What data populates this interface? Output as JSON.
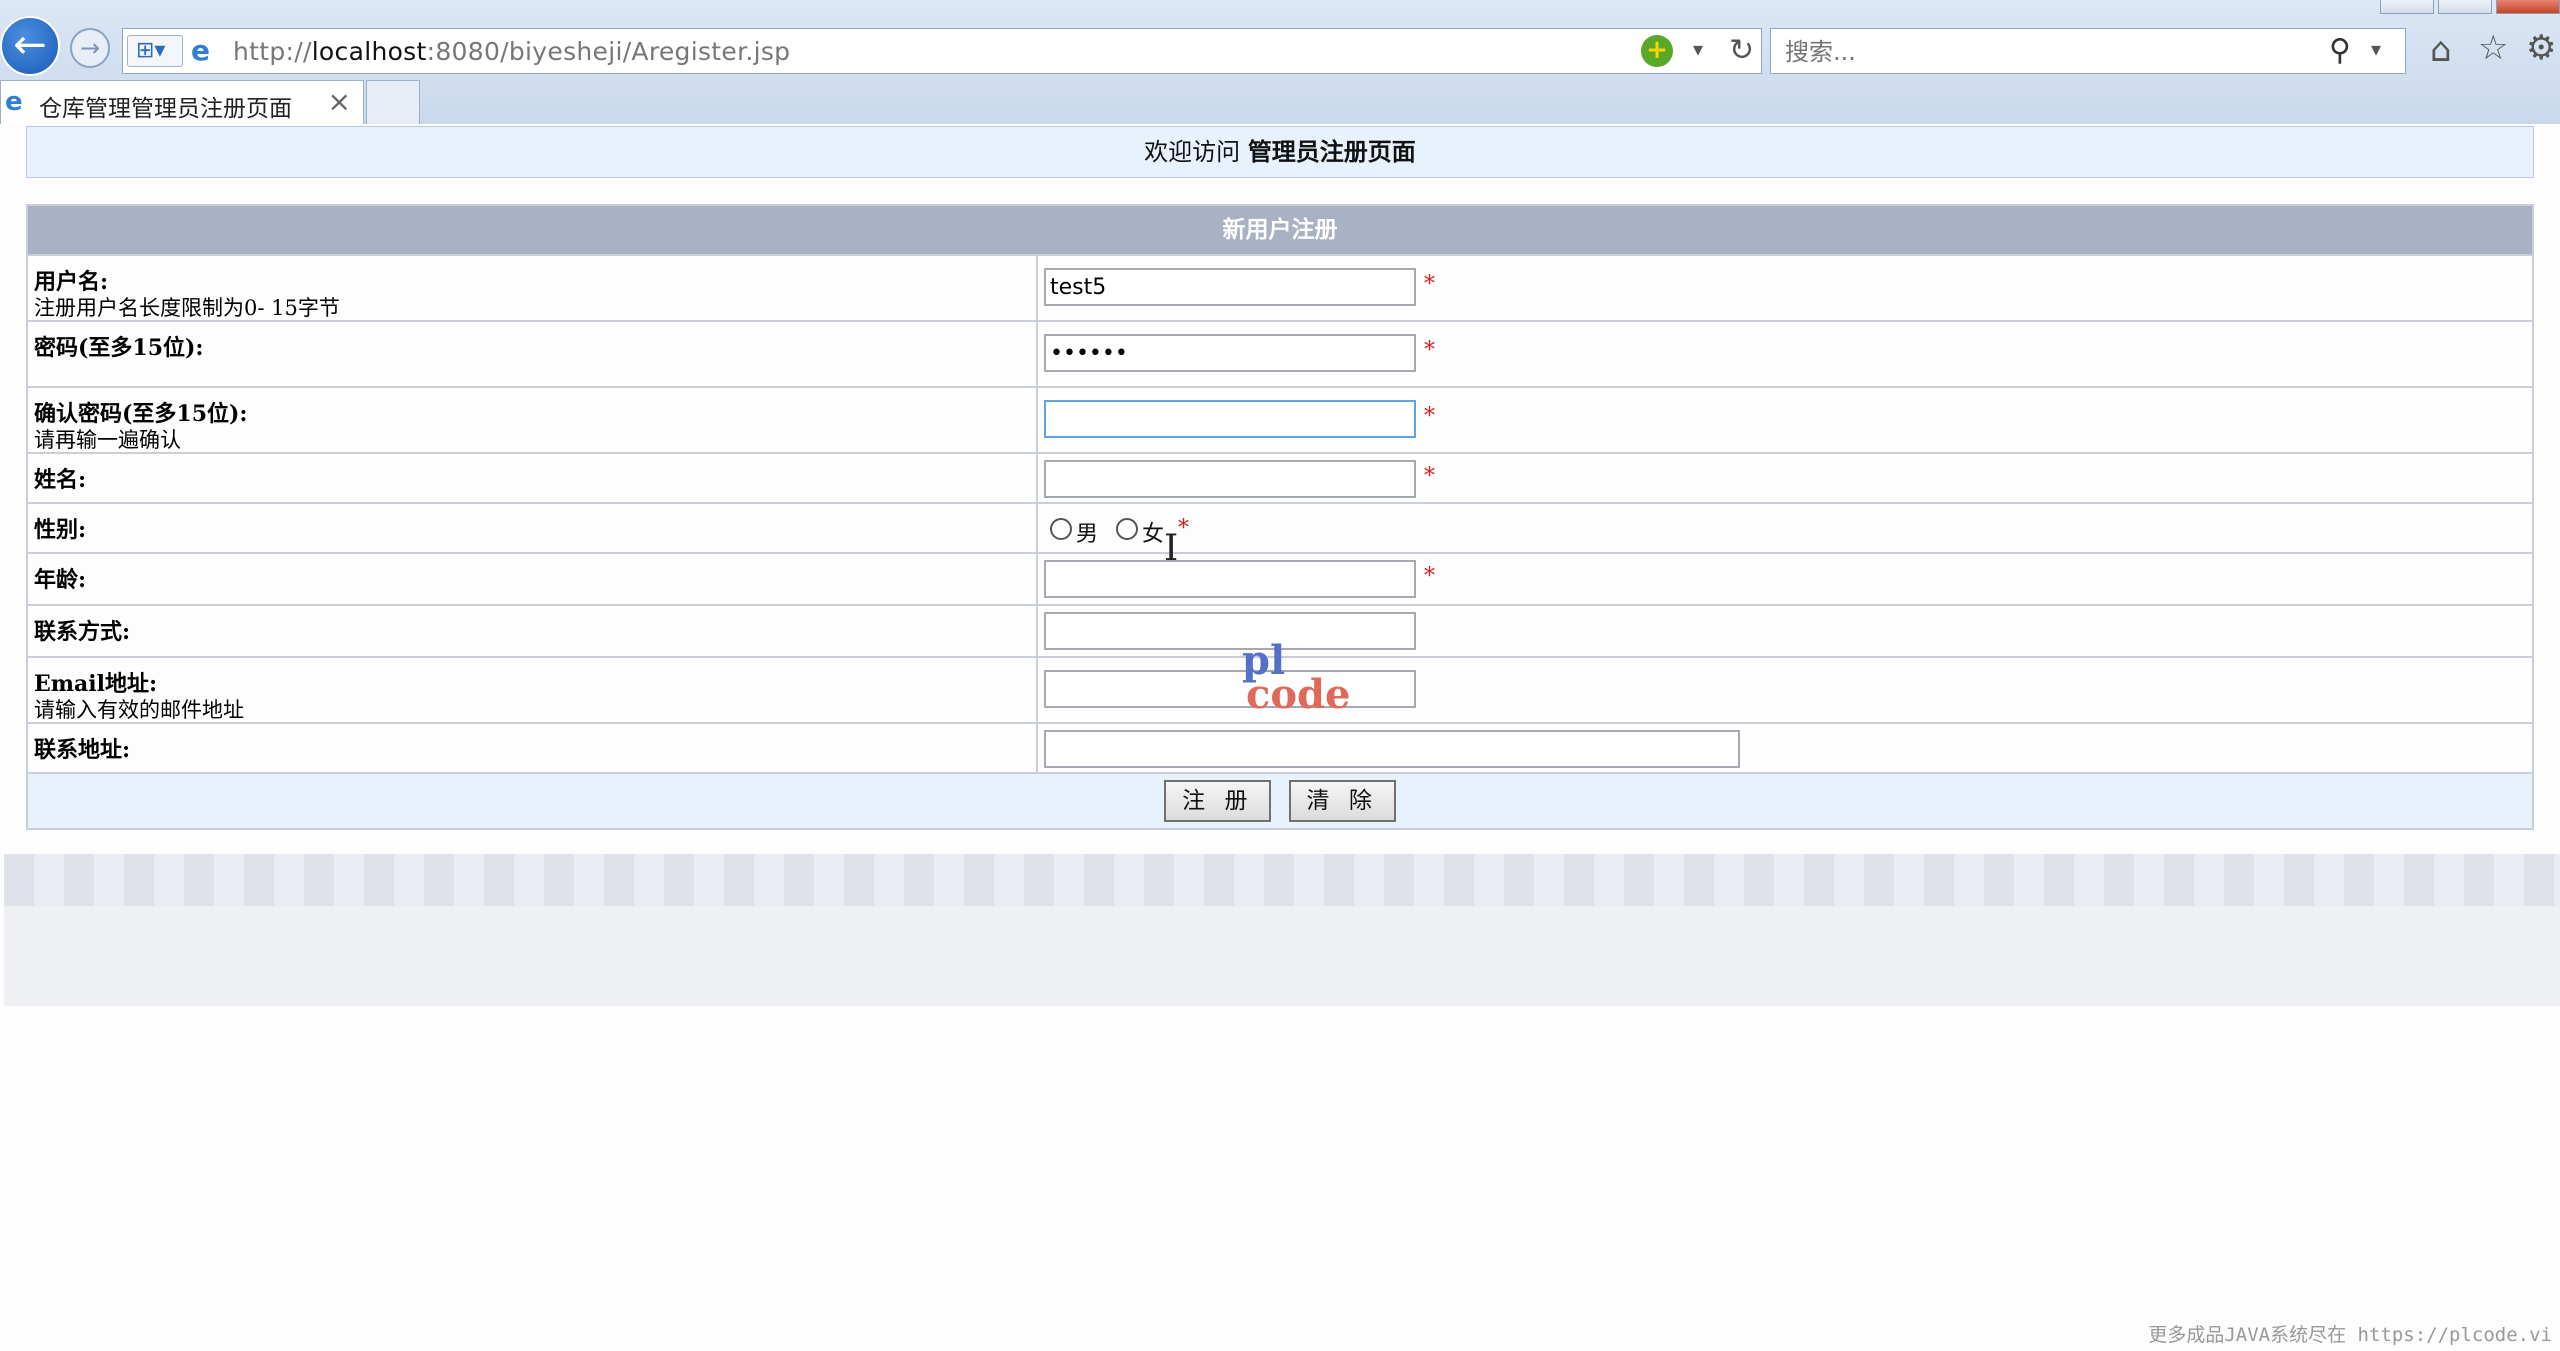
{
  "browser": {
    "url_prefix": "http://",
    "url_host": "localhost",
    "url_rest": ":8080/biyesheji/Aregister.jsp",
    "search_placeholder": "搜索...",
    "tab_title": "仓库管理管理员注册页面"
  },
  "page": {
    "welcome_prefix": "欢迎访问",
    "welcome_title": "管理员注册页面",
    "form_title": "新用户注册",
    "required_mark": "*",
    "fields": {
      "username": {
        "label": "用户名:",
        "hint": "注册用户名长度限制为0- 15字节",
        "value": "test5"
      },
      "password": {
        "label": "密码(至多15位):",
        "value": "••••••"
      },
      "confirm": {
        "label": "确认密码(至多15位):",
        "hint": "请再输一遍确认",
        "value": ""
      },
      "name": {
        "label": "姓名:",
        "value": ""
      },
      "gender": {
        "label": "性别:",
        "options": [
          "男",
          "女"
        ]
      },
      "age": {
        "label": "年龄:",
        "value": ""
      },
      "contact": {
        "label": "联系方式:",
        "value": ""
      },
      "email": {
        "label": "Email地址:",
        "hint": "请输入有效的邮件地址",
        "value": ""
      },
      "address": {
        "label": "联系地址:",
        "value": ""
      }
    },
    "buttons": {
      "register": "注 册",
      "clear": "清 除"
    }
  },
  "watermark": {
    "line1": "pl",
    "line2": "code"
  },
  "status_text": "更多成品JAVA系统尽在 https://plcode.vi"
}
